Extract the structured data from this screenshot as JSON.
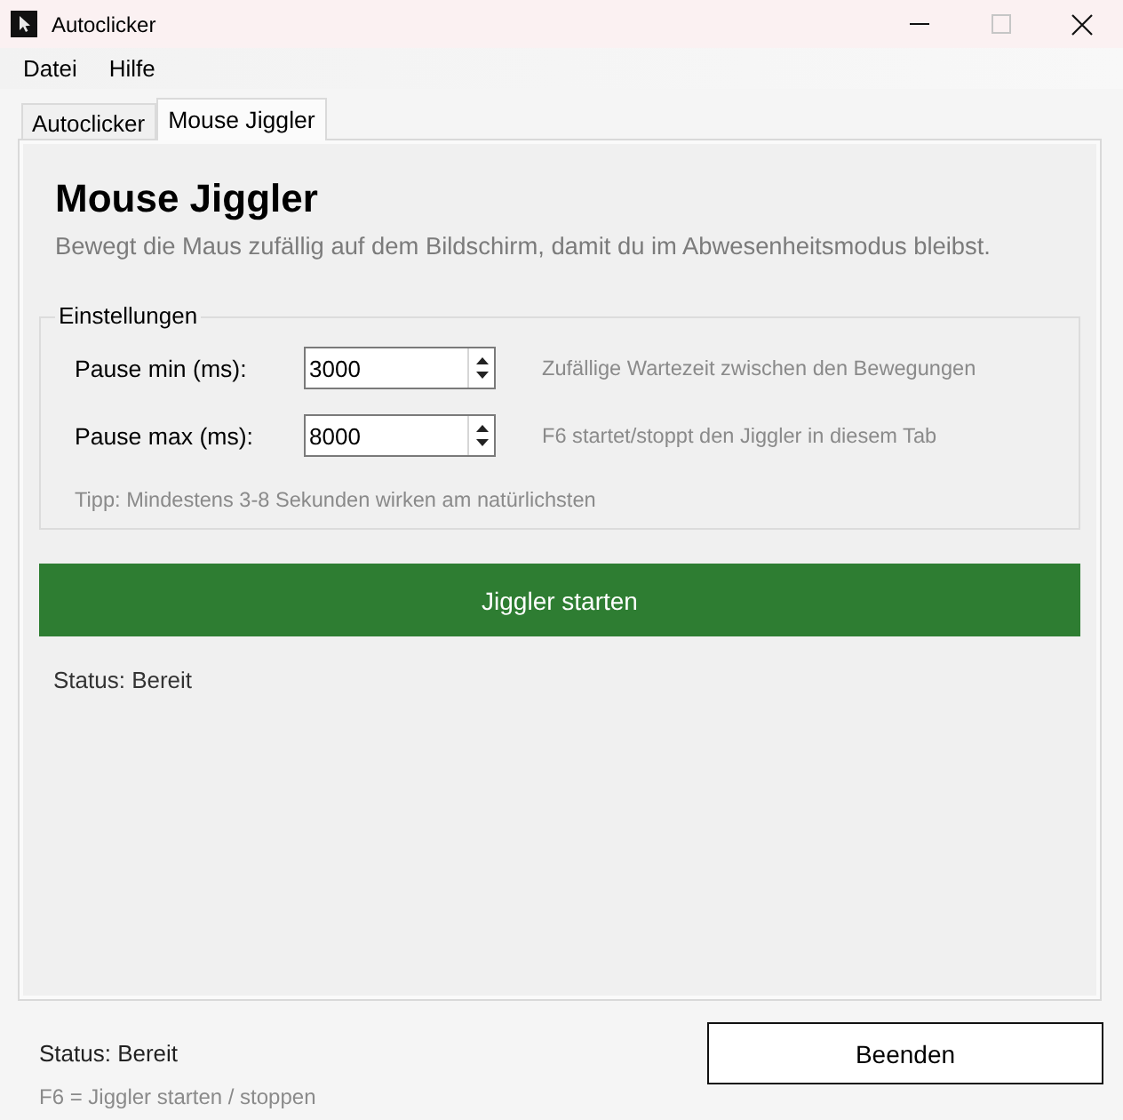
{
  "window": {
    "title": "Autoclicker",
    "controls": [
      {
        "kind": "minimize",
        "disabled": false
      },
      {
        "kind": "maximize",
        "disabled": true
      },
      {
        "kind": "close",
        "disabled": false
      }
    ]
  },
  "menu": [
    {
      "label": "Datei"
    },
    {
      "label": "Hilfe"
    }
  ],
  "tabs": [
    {
      "label": "Autoclicker",
      "selected": false
    },
    {
      "label": "Mouse Jiggler",
      "selected": true
    }
  ],
  "page": {
    "heading": "Mouse Jiggler",
    "description": "Bewegt die Maus zufällig auf dem Bildschirm, damit du im Abwesenheitsmodus bleibst.",
    "settings": {
      "title": "Einstellungen",
      "fields": [
        {
          "label": "Pause min (ms):",
          "value": "3000",
          "hint": "Zufällige Wartezeit zwischen den Bewegungen"
        },
        {
          "label": "Pause max (ms):",
          "value": "8000",
          "hint": "F6 startet/stoppt den Jiggler in diesem Tab"
        }
      ],
      "tip": "Tipp: Mindestens 3-8 Sekunden wirken am natürlichsten"
    },
    "start_button": "Jiggler starten",
    "status": "Status: Bereit"
  },
  "footer": {
    "status": "Status: Bereit",
    "shortcut_hint": "F6 = Jiggler starten / stoppen",
    "quit_button": "Beenden"
  }
}
